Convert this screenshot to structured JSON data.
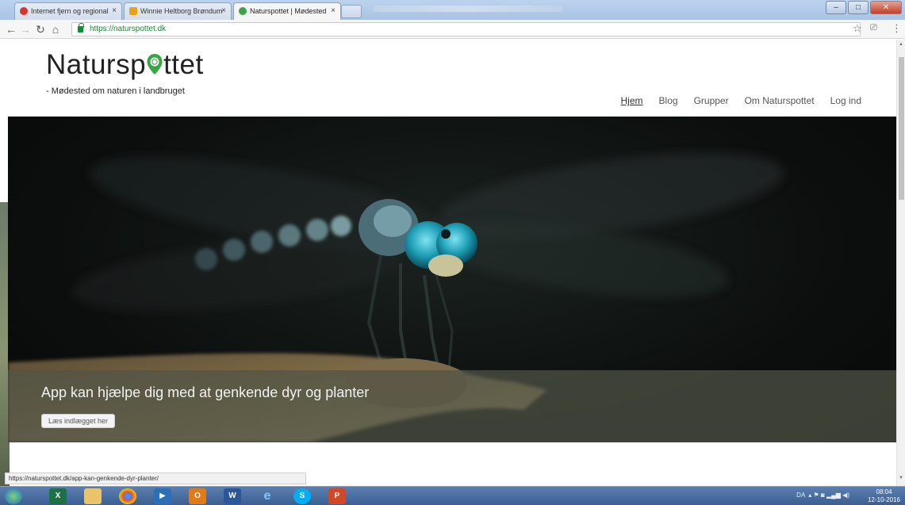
{
  "browser": {
    "tabs": [
      {
        "title": "Internet fjern og regional",
        "active": false,
        "favicon_color": "#d9352a"
      },
      {
        "title": "Winnie Heltborg Brøndum",
        "active": false,
        "favicon_color": "#e8a21a"
      },
      {
        "title": "Naturspottet | Mødested",
        "active": true,
        "favicon_color": "#3aa547"
      }
    ],
    "url": "https://naturspottet.dk",
    "status_url": "https://naturspottet.dk/app-kan-genkende-dyr-planter/"
  },
  "site": {
    "logo_text_start": "Natursp",
    "logo_text_end": "ttet",
    "tagline": "- Mødested om naturen i landbruget",
    "nav": [
      {
        "label": "Hjem",
        "active": true
      },
      {
        "label": "Blog",
        "active": false
      },
      {
        "label": "Grupper",
        "active": false
      },
      {
        "label": "Om Naturspottet",
        "active": false
      },
      {
        "label": "Log ind",
        "active": false
      }
    ],
    "hero": {
      "caption": "App kan hjælpe dig med at genkende dyr og planter",
      "button": "Læs indlægget her"
    }
  },
  "taskbar": {
    "lang": "DA",
    "time": "08:04",
    "date": "12-10-2016"
  },
  "colors": {
    "pin_green": "#3aa547",
    "secure_green": "#138a36"
  }
}
